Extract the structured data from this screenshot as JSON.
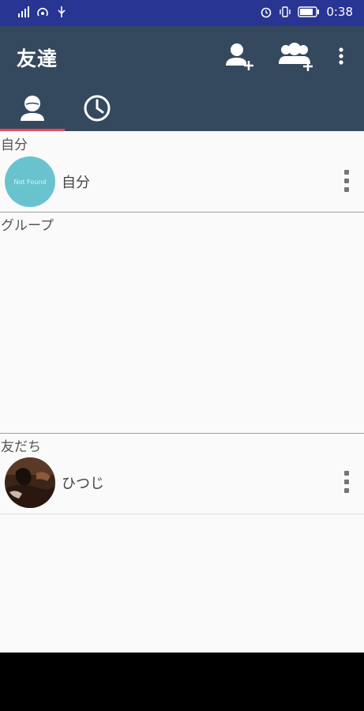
{
  "status_bar": {
    "time": "0:38",
    "left_icons": [
      "signal-icon",
      "hotspot-icon",
      "usb-icon"
    ],
    "right_icons": [
      "alarm-icon",
      "vibrate-icon",
      "battery-icon"
    ]
  },
  "app_bar": {
    "title": "友達",
    "actions": [
      "add-friend-icon",
      "add-group-icon",
      "overflow-menu-icon"
    ]
  },
  "tabs": [
    {
      "icon": "person-icon",
      "selected": true
    },
    {
      "icon": "clock-icon",
      "selected": false
    }
  ],
  "colors": {
    "status_bar": "#283593",
    "app_bar": "#34495e",
    "tab_indicator": "#e84a5f",
    "avatar_placeholder": "#69c3cf"
  },
  "sections": {
    "self": {
      "header": "自分",
      "item": {
        "name": "自分",
        "avatar_text": "Not Found"
      }
    },
    "group": {
      "header": "グループ"
    },
    "friends": {
      "header": "友だち",
      "item": {
        "name": "ひつじ"
      }
    }
  }
}
